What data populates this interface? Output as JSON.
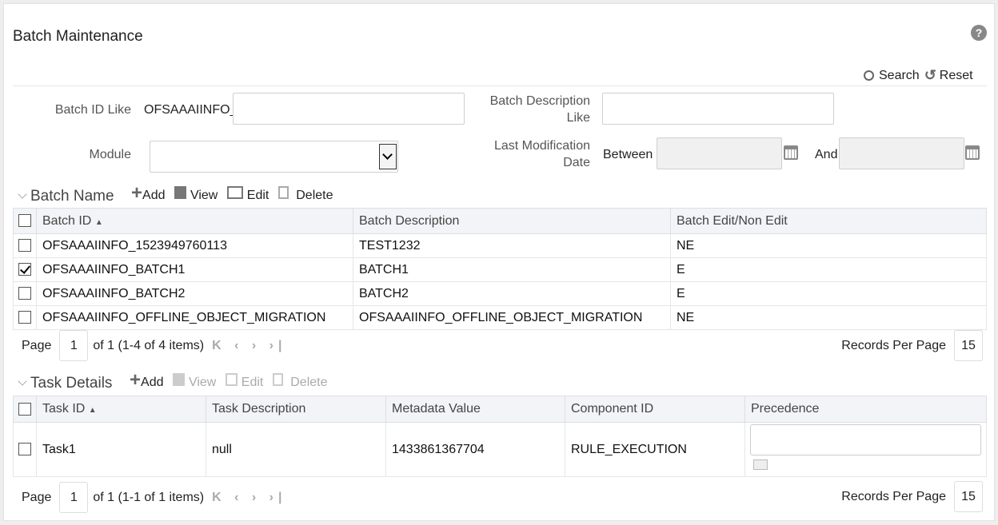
{
  "title": "Batch Maintenance",
  "actions": {
    "search": "Search",
    "reset": "Reset"
  },
  "filters": {
    "batch_id_label": "Batch ID Like",
    "batch_id_prefix": "OFSAAAIINFO_",
    "batch_id_value": "",
    "batch_desc_label_1": "Batch Description",
    "batch_desc_label_2": "Like",
    "batch_desc_value": "",
    "module_label": "Module",
    "module_value": "",
    "lastmod_label_1": "Last Modification",
    "lastmod_label_2": "Date",
    "between": "Between",
    "and": "And"
  },
  "batch": {
    "section": "Batch Name",
    "toolbar": {
      "add": "Add",
      "view": "View",
      "edit": "Edit",
      "delete": "Delete"
    },
    "columns": [
      "Batch ID",
      "Batch Description",
      "Batch Edit/Non Edit"
    ],
    "rows": [
      {
        "id": "OFSAAAIINFO_1523949760113",
        "desc": "TEST1232",
        "edit": "NE",
        "checked": false
      },
      {
        "id": "OFSAAAIINFO_BATCH1",
        "desc": "BATCH1",
        "edit": "E",
        "checked": true
      },
      {
        "id": "OFSAAAIINFO_BATCH2",
        "desc": "BATCH2",
        "edit": "E",
        "checked": false
      },
      {
        "id": "OFSAAAIINFO_OFFLINE_OBJECT_MIGRATION",
        "desc": "OFSAAAIINFO_OFFLINE_OBJECT_MIGRATION",
        "edit": "NE",
        "checked": false
      }
    ],
    "pagination": {
      "page_label": "Page",
      "page": "1",
      "summary": "of 1 (1-4 of 4 items)",
      "rpp_label": "Records Per Page",
      "rpp": "15"
    }
  },
  "task": {
    "section": "Task Details",
    "toolbar": {
      "add": "Add",
      "view": "View",
      "edit": "Edit",
      "delete": "Delete"
    },
    "columns": [
      "Task ID",
      "Task Description",
      "Metadata Value",
      "Component ID",
      "Precedence"
    ],
    "rows": [
      {
        "id": "Task1",
        "desc": "null",
        "metadata": "1433861367704",
        "component": "RULE_EXECUTION",
        "precedence": ""
      }
    ],
    "pagination": {
      "page_label": "Page",
      "page": "1",
      "summary": "of 1 (1-1 of 1 items)",
      "rpp_label": "Records Per Page",
      "rpp": "15"
    }
  }
}
